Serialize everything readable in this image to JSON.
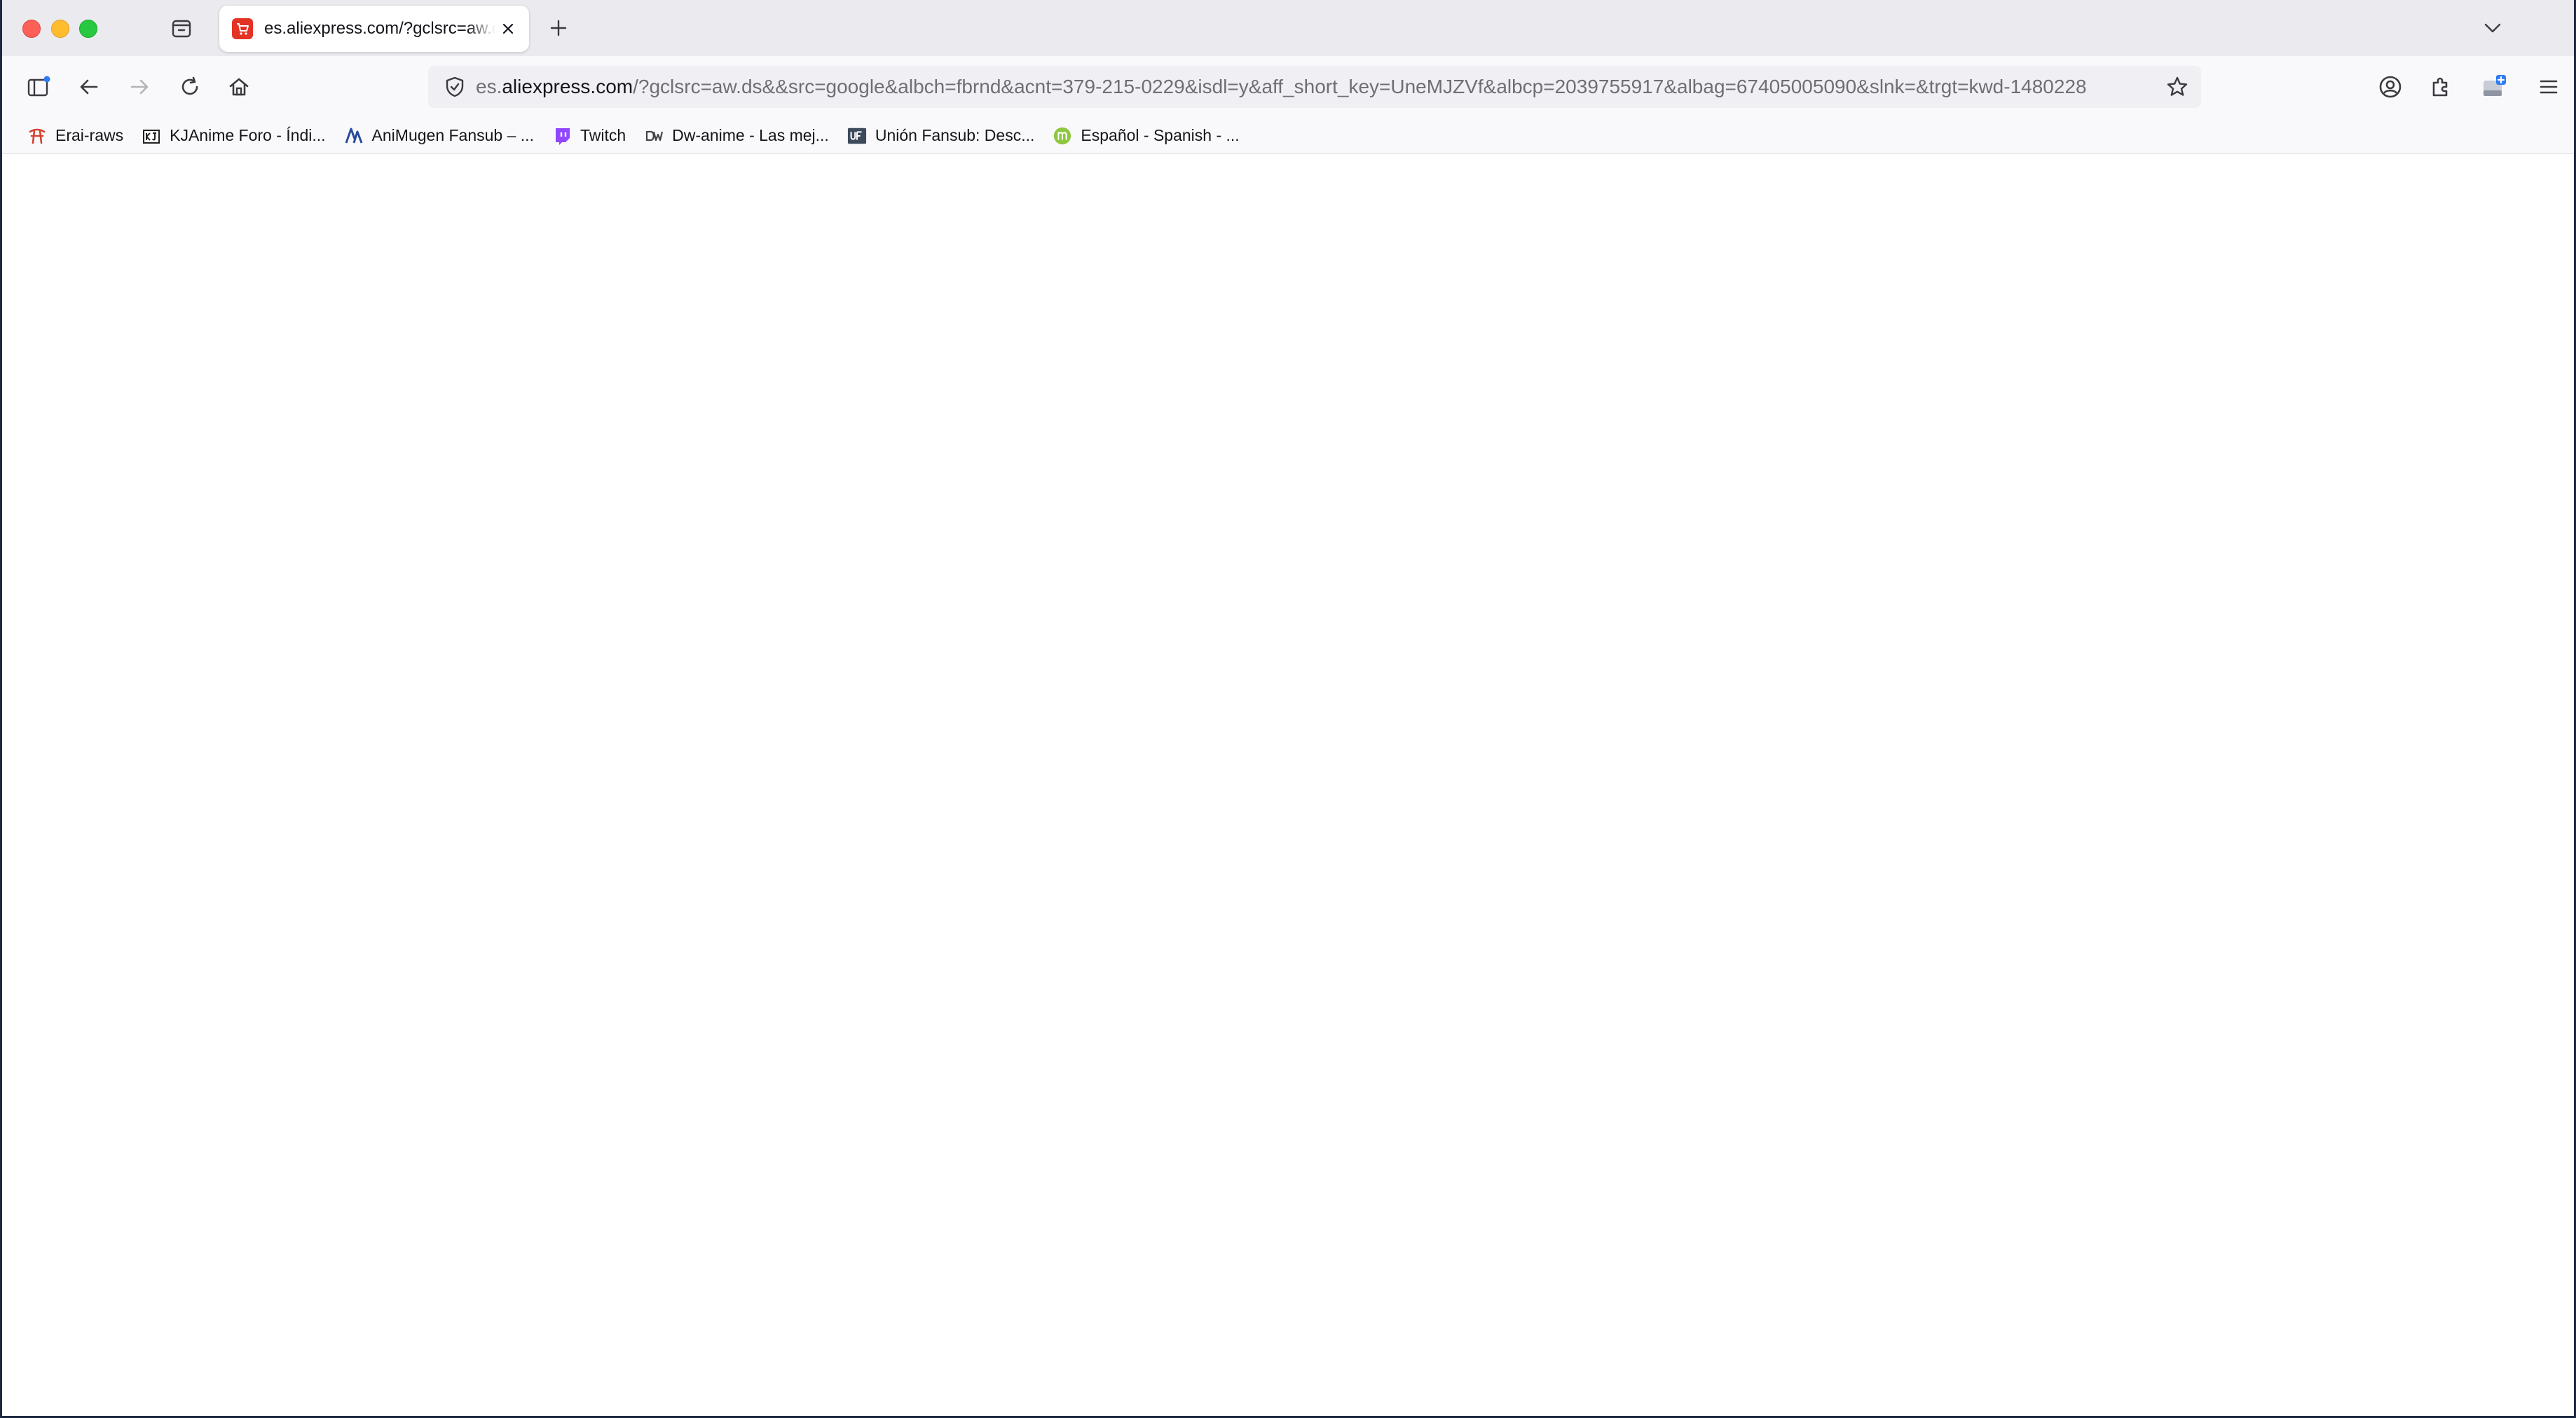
{
  "tabs": [
    {
      "title": "es.aliexpress.com/?gclsrc=aw.ds&&src=google",
      "favicon": "aliexpress-cart-icon",
      "active": true
    }
  ],
  "urlbar": {
    "url_prefix": "es.",
    "url_domain": "aliexpress.com",
    "url_rest": "/?gclsrc=aw.ds&&src=google&albch=fbrnd&acnt=379-215-0229&isdl=y&aff_short_key=UneMJZVf&albcp=2039755917&albag=67405005090&slnk=&trgt=kwd-1480228"
  },
  "bookmarks": [
    {
      "label": "Erai-raws",
      "icon": "erai-raws-icon"
    },
    {
      "label": "KJAnime Foro - Índi...",
      "icon": "kjanime-icon"
    },
    {
      "label": "AniMugen Fansub – ...",
      "icon": "animugen-icon"
    },
    {
      "label": "Twitch",
      "icon": "twitch-icon"
    },
    {
      "label": "Dw-anime - Las mej...",
      "icon": "dw-anime-icon"
    },
    {
      "label": "Unión Fansub: Desc...",
      "icon": "union-fansub-icon"
    },
    {
      "label": "Español - Spanish - ...",
      "icon": "spanish-forum-icon"
    }
  ],
  "colors": {
    "tabstrip_bg": "#ebebef",
    "toolbar_bg": "#f9f9fb",
    "urlbar_bg": "#f0f0f4",
    "favicon_red": "#e43225",
    "twitch_purple": "#9146ff"
  }
}
